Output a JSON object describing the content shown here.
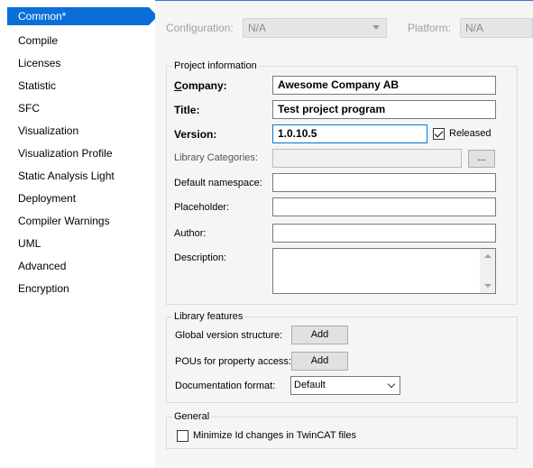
{
  "nav": {
    "items": [
      {
        "label": "Common*",
        "selected": true
      },
      {
        "label": "Compile"
      },
      {
        "label": "Licenses"
      },
      {
        "label": "Statistic"
      },
      {
        "label": "SFC"
      },
      {
        "label": "Visualization"
      },
      {
        "label": "Visualization Profile"
      },
      {
        "label": "Static Analysis Light"
      },
      {
        "label": "Deployment"
      },
      {
        "label": "Compiler Warnings"
      },
      {
        "label": "UML"
      },
      {
        "label": "Advanced"
      },
      {
        "label": "Encryption"
      }
    ]
  },
  "top": {
    "configuration_label": "Configuration:",
    "configuration_value": "N/A",
    "platform_label": "Platform:",
    "platform_value": "N/A"
  },
  "project_info": {
    "title": "Project information",
    "company_label": "Company:",
    "company_value": "Awesome Company AB",
    "title_label": "Title:",
    "title_value": "Test project program",
    "version_label": "Version:",
    "version_value": "1.0.10.5",
    "released_label": "Released",
    "released_checked": true,
    "library_categories_label": "Library Categories:",
    "library_categories_value": "",
    "browse_label": "...",
    "default_namespace_label": "Default namespace:",
    "default_namespace_value": "",
    "placeholder_label": "Placeholder:",
    "placeholder_value": "",
    "author_label": "Author:",
    "author_value": "",
    "description_label": "Description:",
    "description_value": ""
  },
  "library_features": {
    "title": "Library features",
    "global_version_label": "Global version structure:",
    "global_version_button": "Add",
    "pous_label": "POUs for property access:",
    "pous_button": "Add",
    "doc_format_label": "Documentation format:",
    "doc_format_value": "Default"
  },
  "general": {
    "title": "General",
    "minimize_label": "Minimize Id changes in TwinCAT files",
    "minimize_checked": false
  },
  "colors": {
    "accent": "#0a6fd8",
    "panel_bg": "#f5f5f5"
  }
}
